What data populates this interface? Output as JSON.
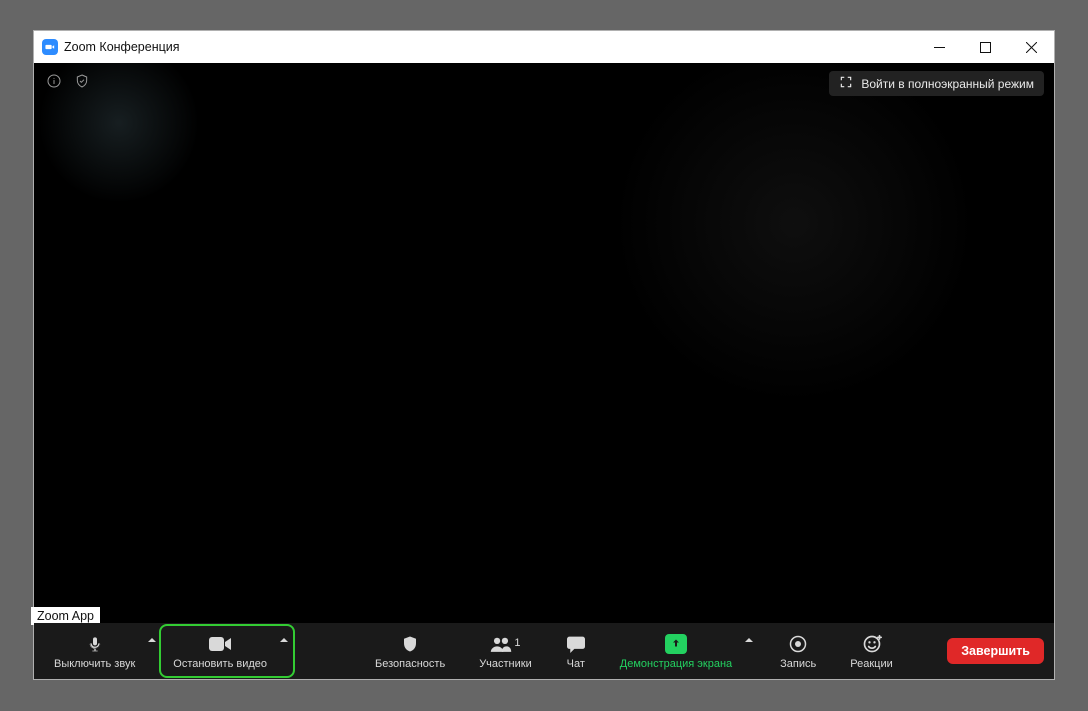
{
  "window": {
    "title": "Zoom Конференция",
    "app_badge": "Zoom App"
  },
  "top": {
    "fullscreen_label": "Войти в полноэкранный режим"
  },
  "toolbar": {
    "mute": "Выключить звук",
    "video": "Остановить видео",
    "security": "Безопасность",
    "participants": "Участники",
    "participants_count": "1",
    "chat": "Чат",
    "share": "Демонстрация экрана",
    "record": "Запись",
    "reactions": "Реакции",
    "end": "Завершить"
  }
}
